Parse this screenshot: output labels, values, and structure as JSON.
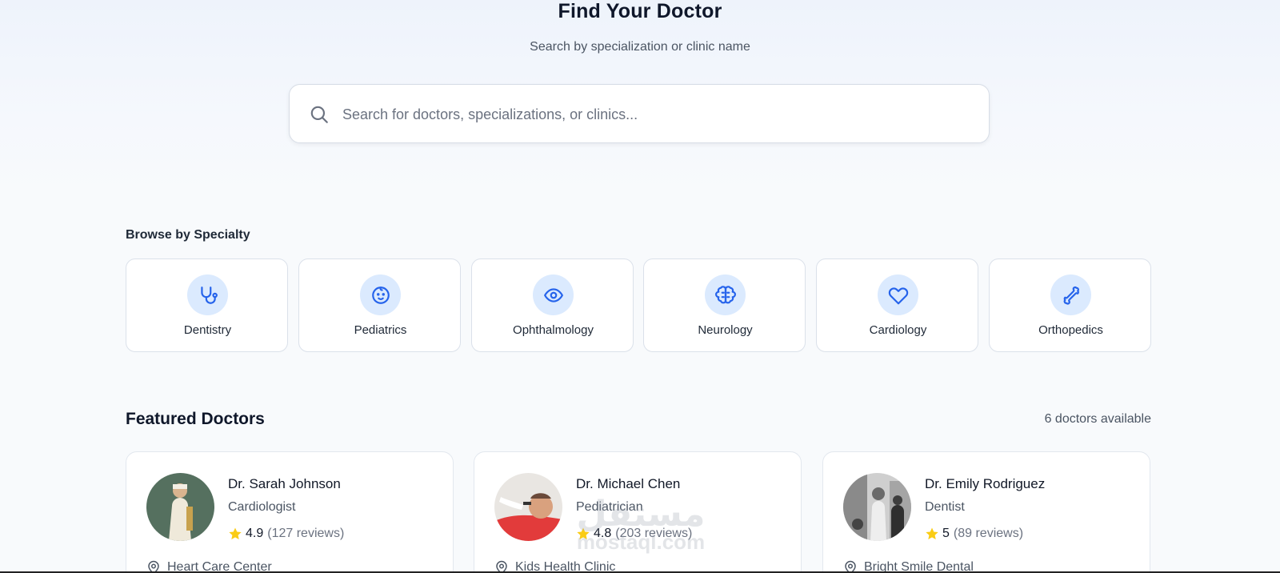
{
  "hero": {
    "title": "Find Your Doctor",
    "subtitle": "Search by specialization or clinic name"
  },
  "search": {
    "placeholder": "Search for doctors, specializations, or clinics...",
    "value": "",
    "icon": "search-icon"
  },
  "specialties": {
    "heading": "Browse by Specialty",
    "items": [
      {
        "label": "Dentistry",
        "icon": "stethoscope-icon"
      },
      {
        "label": "Pediatrics",
        "icon": "baby-icon"
      },
      {
        "label": "Ophthalmology",
        "icon": "eye-icon"
      },
      {
        "label": "Neurology",
        "icon": "brain-icon"
      },
      {
        "label": "Cardiology",
        "icon": "heart-icon"
      },
      {
        "label": "Orthopedics",
        "icon": "bone-icon"
      }
    ],
    "icon_color": "#2563eb",
    "icon_bg": "#dbeafe"
  },
  "featured": {
    "heading": "Featured Doctors",
    "count_text": "6 doctors available",
    "doctors": [
      {
        "name": "Dr. Sarah Johnson",
        "specialty": "Cardiologist",
        "rating": "4.9",
        "reviews": "(127 reviews)",
        "location": "Heart Care Center"
      },
      {
        "name": "Dr. Michael Chen",
        "specialty": "Pediatrician",
        "rating": "4.8",
        "reviews": "(203 reviews)",
        "location": "Kids Health Clinic"
      },
      {
        "name": "Dr. Emily Rodriguez",
        "specialty": "Dentist",
        "rating": "5",
        "reviews": "(89 reviews)",
        "location": "Bright Smile Dental"
      }
    ],
    "star_color": "#facc15"
  },
  "watermark": {
    "arabic": "مستقل",
    "latin": "mostaql.com"
  }
}
